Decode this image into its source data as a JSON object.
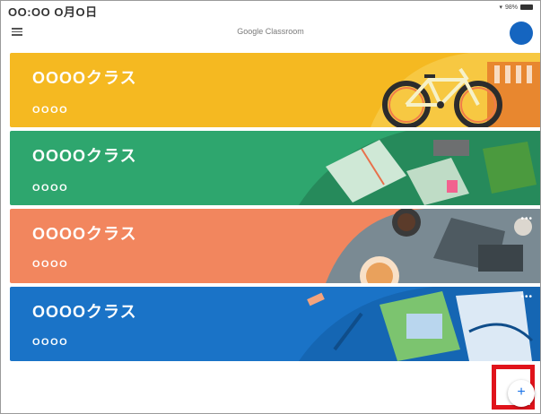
{
  "status": {
    "time": "OO:OO O月O日",
    "battery": "98%"
  },
  "app": {
    "title": "Google Classroom"
  },
  "classes": [
    {
      "name": "OOOOクラス",
      "section": "OOOO",
      "color": "#f5b921"
    },
    {
      "name": "OOOOクラス",
      "section": "OOOO",
      "color": "#2ea66e"
    },
    {
      "name": "OOOOクラス",
      "section": "OOOO",
      "color": "#f2865e"
    },
    {
      "name": "OOOOクラス",
      "section": "OOOO",
      "color": "#1a73c7"
    }
  ],
  "fab": {
    "label": "+",
    "highlight_color": "#e0131b"
  }
}
